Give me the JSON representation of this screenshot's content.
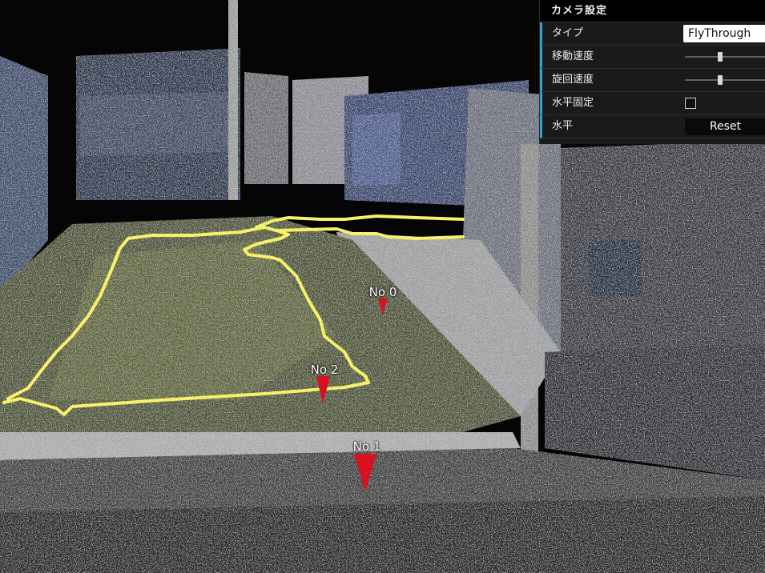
{
  "panel": {
    "title": "カメラ設定",
    "rows": [
      {
        "label": "タイプ",
        "value": "FlyThrough"
      },
      {
        "label": "移動速度",
        "level": 0.44
      },
      {
        "label": "旋回速度",
        "level": 0.44
      },
      {
        "label": "水平固定",
        "checked": false
      },
      {
        "label": "水平",
        "button": "Reset"
      }
    ]
  },
  "markers": [
    {
      "label": "No 0"
    },
    {
      "label": "No 2"
    },
    {
      "label": "No 1"
    }
  ],
  "colors": {
    "background": "#050505",
    "boundary_line": "#f7f06a",
    "marker": "#d81020",
    "panel_bg": "#1a1a1a",
    "panel_accent": "#2fa1d6"
  }
}
